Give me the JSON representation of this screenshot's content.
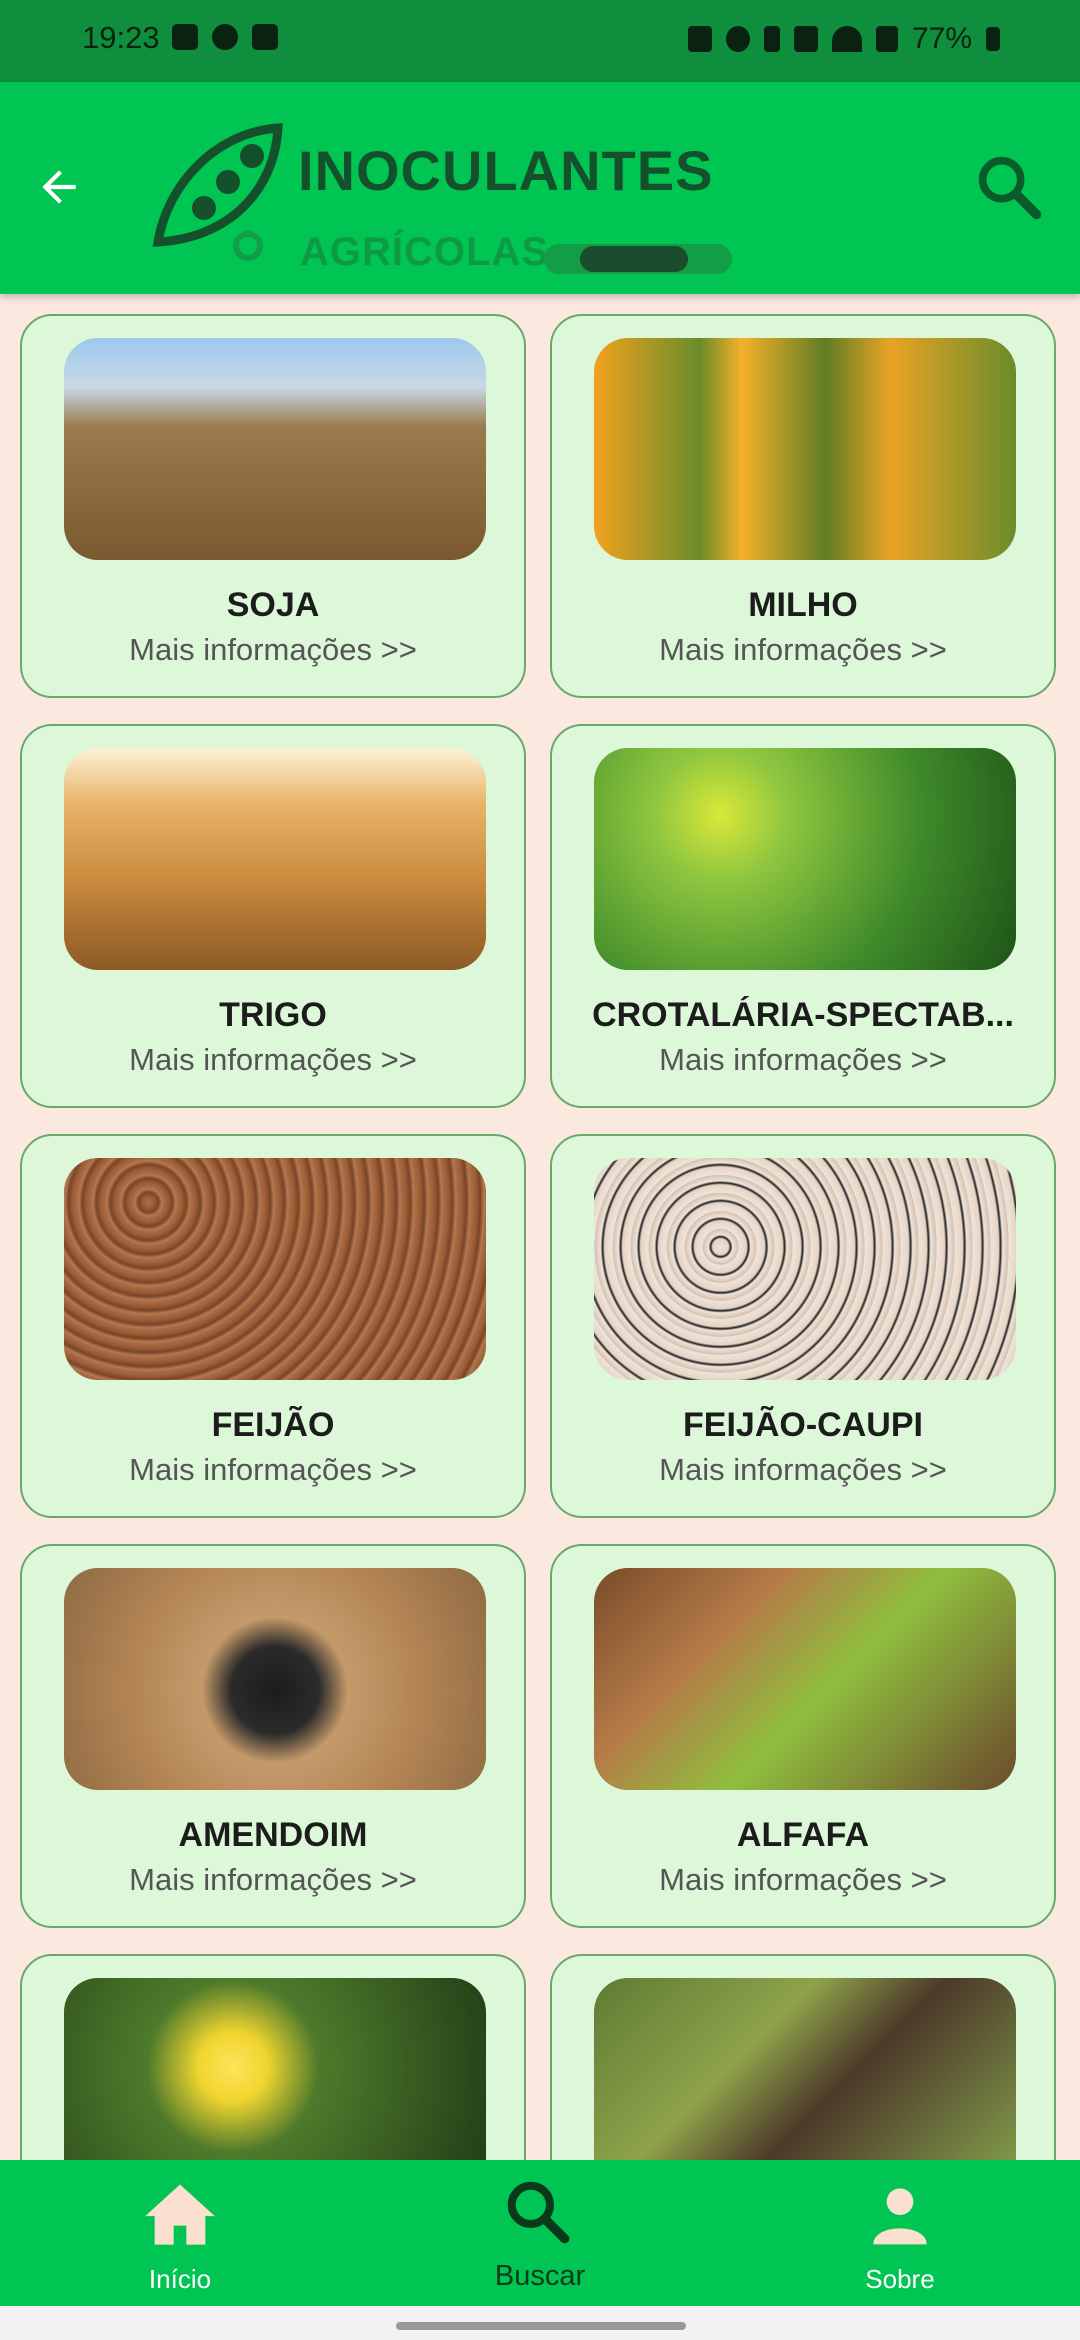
{
  "status_bar": {
    "time": "19:23",
    "battery": "77%"
  },
  "app_bar": {
    "logo_title": "INOCULANTES",
    "logo_subtitle": "AGRÍCOLAS",
    "back_icon": "arrow-left-icon",
    "search_icon": "search-icon"
  },
  "cards": [
    {
      "title": "SOJA",
      "link": "Mais informações >>",
      "image": "soybean-pods-photo"
    },
    {
      "title": "MILHO",
      "link": "Mais informações >>",
      "image": "corn-cobs-photo"
    },
    {
      "title": "TRIGO",
      "link": "Mais informações >>",
      "image": "wheat-field-photo"
    },
    {
      "title": "CROTALÁRIA-SPECTAB...",
      "link": "Mais informações >>",
      "image": "crotalaria-plant-photo"
    },
    {
      "title": "FEIJÃO",
      "link": "Mais informações >>",
      "image": "brown-beans-photo"
    },
    {
      "title": "FEIJÃO-CAUPI",
      "link": "Mais informações >>",
      "image": "black-eyed-peas-photo"
    },
    {
      "title": "AMENDOIM",
      "link": "Mais informações >>",
      "image": "peanuts-photo"
    },
    {
      "title": "ALFAFA",
      "link": "Mais informações >>",
      "image": "alfalfa-sprouts-photo"
    },
    {
      "title": "",
      "link": "",
      "image": "yellow-flower-photo"
    },
    {
      "title": "",
      "link": "",
      "image": "seed-pods-photo"
    }
  ],
  "bottom_nav": {
    "home_label": "Início",
    "search_label": "Buscar",
    "about_label": "Sobre"
  },
  "colors": {
    "primary_green": "#00c553",
    "status_bar": "#0f8f3e",
    "card_bg": "#dcf8d9",
    "page_bg": "#fbe8df"
  }
}
